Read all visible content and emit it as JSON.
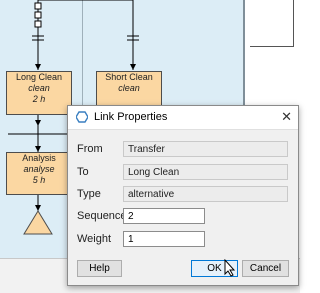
{
  "diagram": {
    "nodes": [
      {
        "title": "Long Clean",
        "subtitle": "clean",
        "duration": "2 h"
      },
      {
        "title": "Short Clean",
        "subtitle": "clean",
        "duration": ""
      },
      {
        "title": "Analysis",
        "subtitle": "analyse",
        "duration": "5 h"
      }
    ]
  },
  "dialog": {
    "title": "Link Properties",
    "fields": {
      "from": {
        "label": "From",
        "value": "Transfer"
      },
      "to": {
        "label": "To",
        "value": "Long Clean"
      },
      "type": {
        "label": "Type",
        "value": "alternative"
      },
      "sequence": {
        "label": "Sequence",
        "value": "2"
      },
      "weight": {
        "label": "Weight",
        "value": "1"
      }
    },
    "buttons": {
      "help": "Help",
      "ok": "OK",
      "cancel": "Cancel"
    },
    "close_glyph": "✕"
  },
  "icons": {
    "dialog_icon": "hexagon-icon",
    "close": "close-icon",
    "cursor": "mouse-pointer-icon"
  },
  "colors": {
    "lane_background": "#dcedf6",
    "node_fill": "#fbd7a2",
    "ok_border": "#0078d7"
  }
}
